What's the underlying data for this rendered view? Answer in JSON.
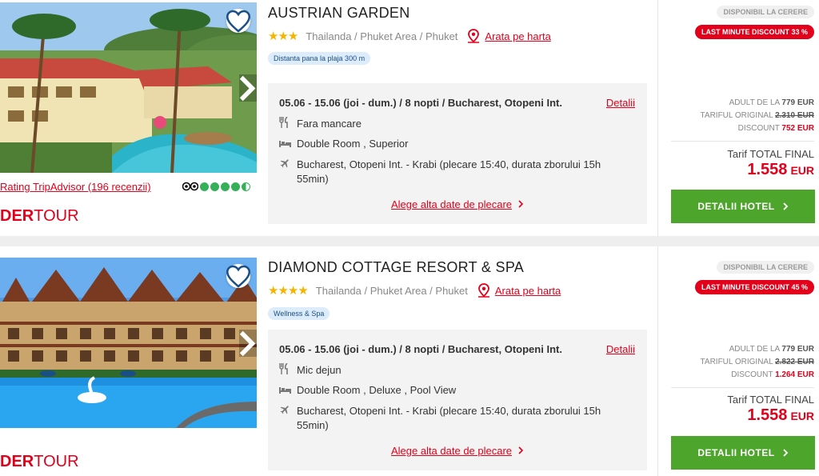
{
  "hotels": [
    {
      "name": "AUSTRIAN GARDEN",
      "stars": "★★★",
      "location": "Thailanda / Phuket Area / Phuket",
      "map_link": "Arata pe harta",
      "tag": "Distanta pana la plaja 300 m",
      "tripadvisor_link": "Rating TripAdvisor (196 recenzii)",
      "tripadvisor_rating": 4.5,
      "operator_logo": "DERTOUR",
      "dates": "05.06 - 15.06 (joi - dum.) / 8 nopti / Bucharest, Otopeni Int.",
      "details_link": "Detalii",
      "meal": "Fara mancare",
      "room": "Double Room , Superior",
      "flight": "Bucharest, Otopeni Int. - Krabi (plecare 15:40, durata zborului 15h 55min)",
      "other_dates_link": "Alege alta date de plecare",
      "availability": "DISPONIBIL LA CERERE",
      "last_minute": "LAST MINUTE DISCOUNT 33 %",
      "adult_label": "ADULT DE LA",
      "adult_price": "779 EUR",
      "original_label": "TARIFUL ORIGINAL",
      "original_price": "2.310 EUR",
      "discount_label": "DISCOUNT",
      "discount_value": "752 EUR",
      "total_label": "Tarif TOTAL FINAL",
      "total_price": "1.558",
      "currency": "EUR",
      "button": "DETALII HOTEL"
    },
    {
      "name": "DIAMOND COTTAGE RESORT & SPA",
      "stars": "★★★★",
      "location": "Thailanda / Phuket Area / Phuket",
      "map_link": "Arata pe harta",
      "tag": "Wellness & Spa",
      "operator_logo": "DERTOUR",
      "dates": "05.06 - 15.06 (joi - dum.) / 8 nopti / Bucharest, Otopeni Int.",
      "details_link": "Detalii",
      "meal": "Mic dejun",
      "room": "Double Room , Deluxe , Pool View",
      "flight": "Bucharest, Otopeni Int. - Krabi (plecare 15:40, durata zborului 15h 55min)",
      "other_dates_link": "Alege alta date de plecare",
      "availability": "DISPONIBIL LA CERERE",
      "last_minute": "LAST MINUTE DISCOUNT 45 %",
      "adult_label": "ADULT DE LA",
      "adult_price": "779 EUR",
      "original_label": "TARIFUL ORIGINAL",
      "original_price": "2.822 EUR",
      "discount_label": "DISCOUNT",
      "discount_value": "1.264 EUR",
      "total_label": "Tarif TOTAL FINAL",
      "total_price": "1.558",
      "currency": "EUR",
      "button": "DETALII HOTEL"
    }
  ],
  "colors": {
    "accent": "#e2001a",
    "button": "#4ea52c",
    "stars": "#f5b400",
    "tag_bg": "#dcecfb",
    "details_bg": "#f3f3f3"
  },
  "icons": [
    "heart-icon",
    "chevron-right-icon",
    "map-pin-icon",
    "fork-knife-icon",
    "bed-icon",
    "plane-icon",
    "tripadvisor-owl-icon"
  ]
}
